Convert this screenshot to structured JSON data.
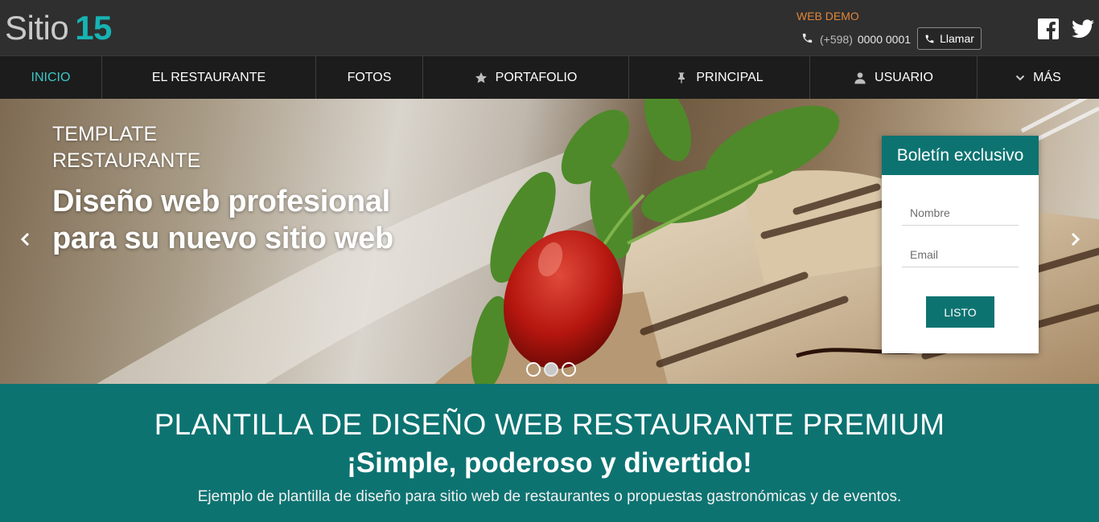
{
  "header": {
    "logo_part1": "Sitio",
    "logo_part2": "15",
    "web_demo_label": "WEB DEMO",
    "phone_prefix": "(+598)",
    "phone_number": "0000 0001",
    "call_button_label": "Llamar",
    "social": [
      "facebook-icon",
      "twitter-icon"
    ]
  },
  "nav": {
    "items": [
      {
        "label": "INICIO",
        "icon": "",
        "active": true
      },
      {
        "label": "EL RESTAURANTE",
        "icon": ""
      },
      {
        "label": "FOTOS",
        "icon": ""
      },
      {
        "label": "PORTAFOLIO",
        "icon": "star-icon"
      },
      {
        "label": "PRINCIPAL",
        "icon": "pin-icon"
      },
      {
        "label": "USUARIO",
        "icon": "user-icon"
      },
      {
        "label": "MÁS",
        "icon": "chevron-down-icon"
      }
    ]
  },
  "hero": {
    "title": "TEMPLATE RESTAURANTE",
    "headline": "Diseño web profesional para su nuevo sitio web",
    "slide_count": 3,
    "active_slide": 2
  },
  "newsletter": {
    "title": "Boletín exclusivo",
    "name_placeholder": "Nombre",
    "email_placeholder": "Email",
    "submit_label": "LISTO"
  },
  "band": {
    "title": "PLANTILLA DE DISEÑO WEB RESTAURANTE PREMIUM",
    "subtitle": "¡Simple, poderoso y divertido!",
    "description": "Ejemplo de plantilla de diseño para sitio web de restaurantes o propuestas gastronómicas y de eventos."
  },
  "colors": {
    "teal": "#0d7371",
    "accent_cyan": "#17b3b3",
    "orange": "#e0873a",
    "topbar": "#2f2f2f",
    "nav": "#1c1c1c"
  }
}
